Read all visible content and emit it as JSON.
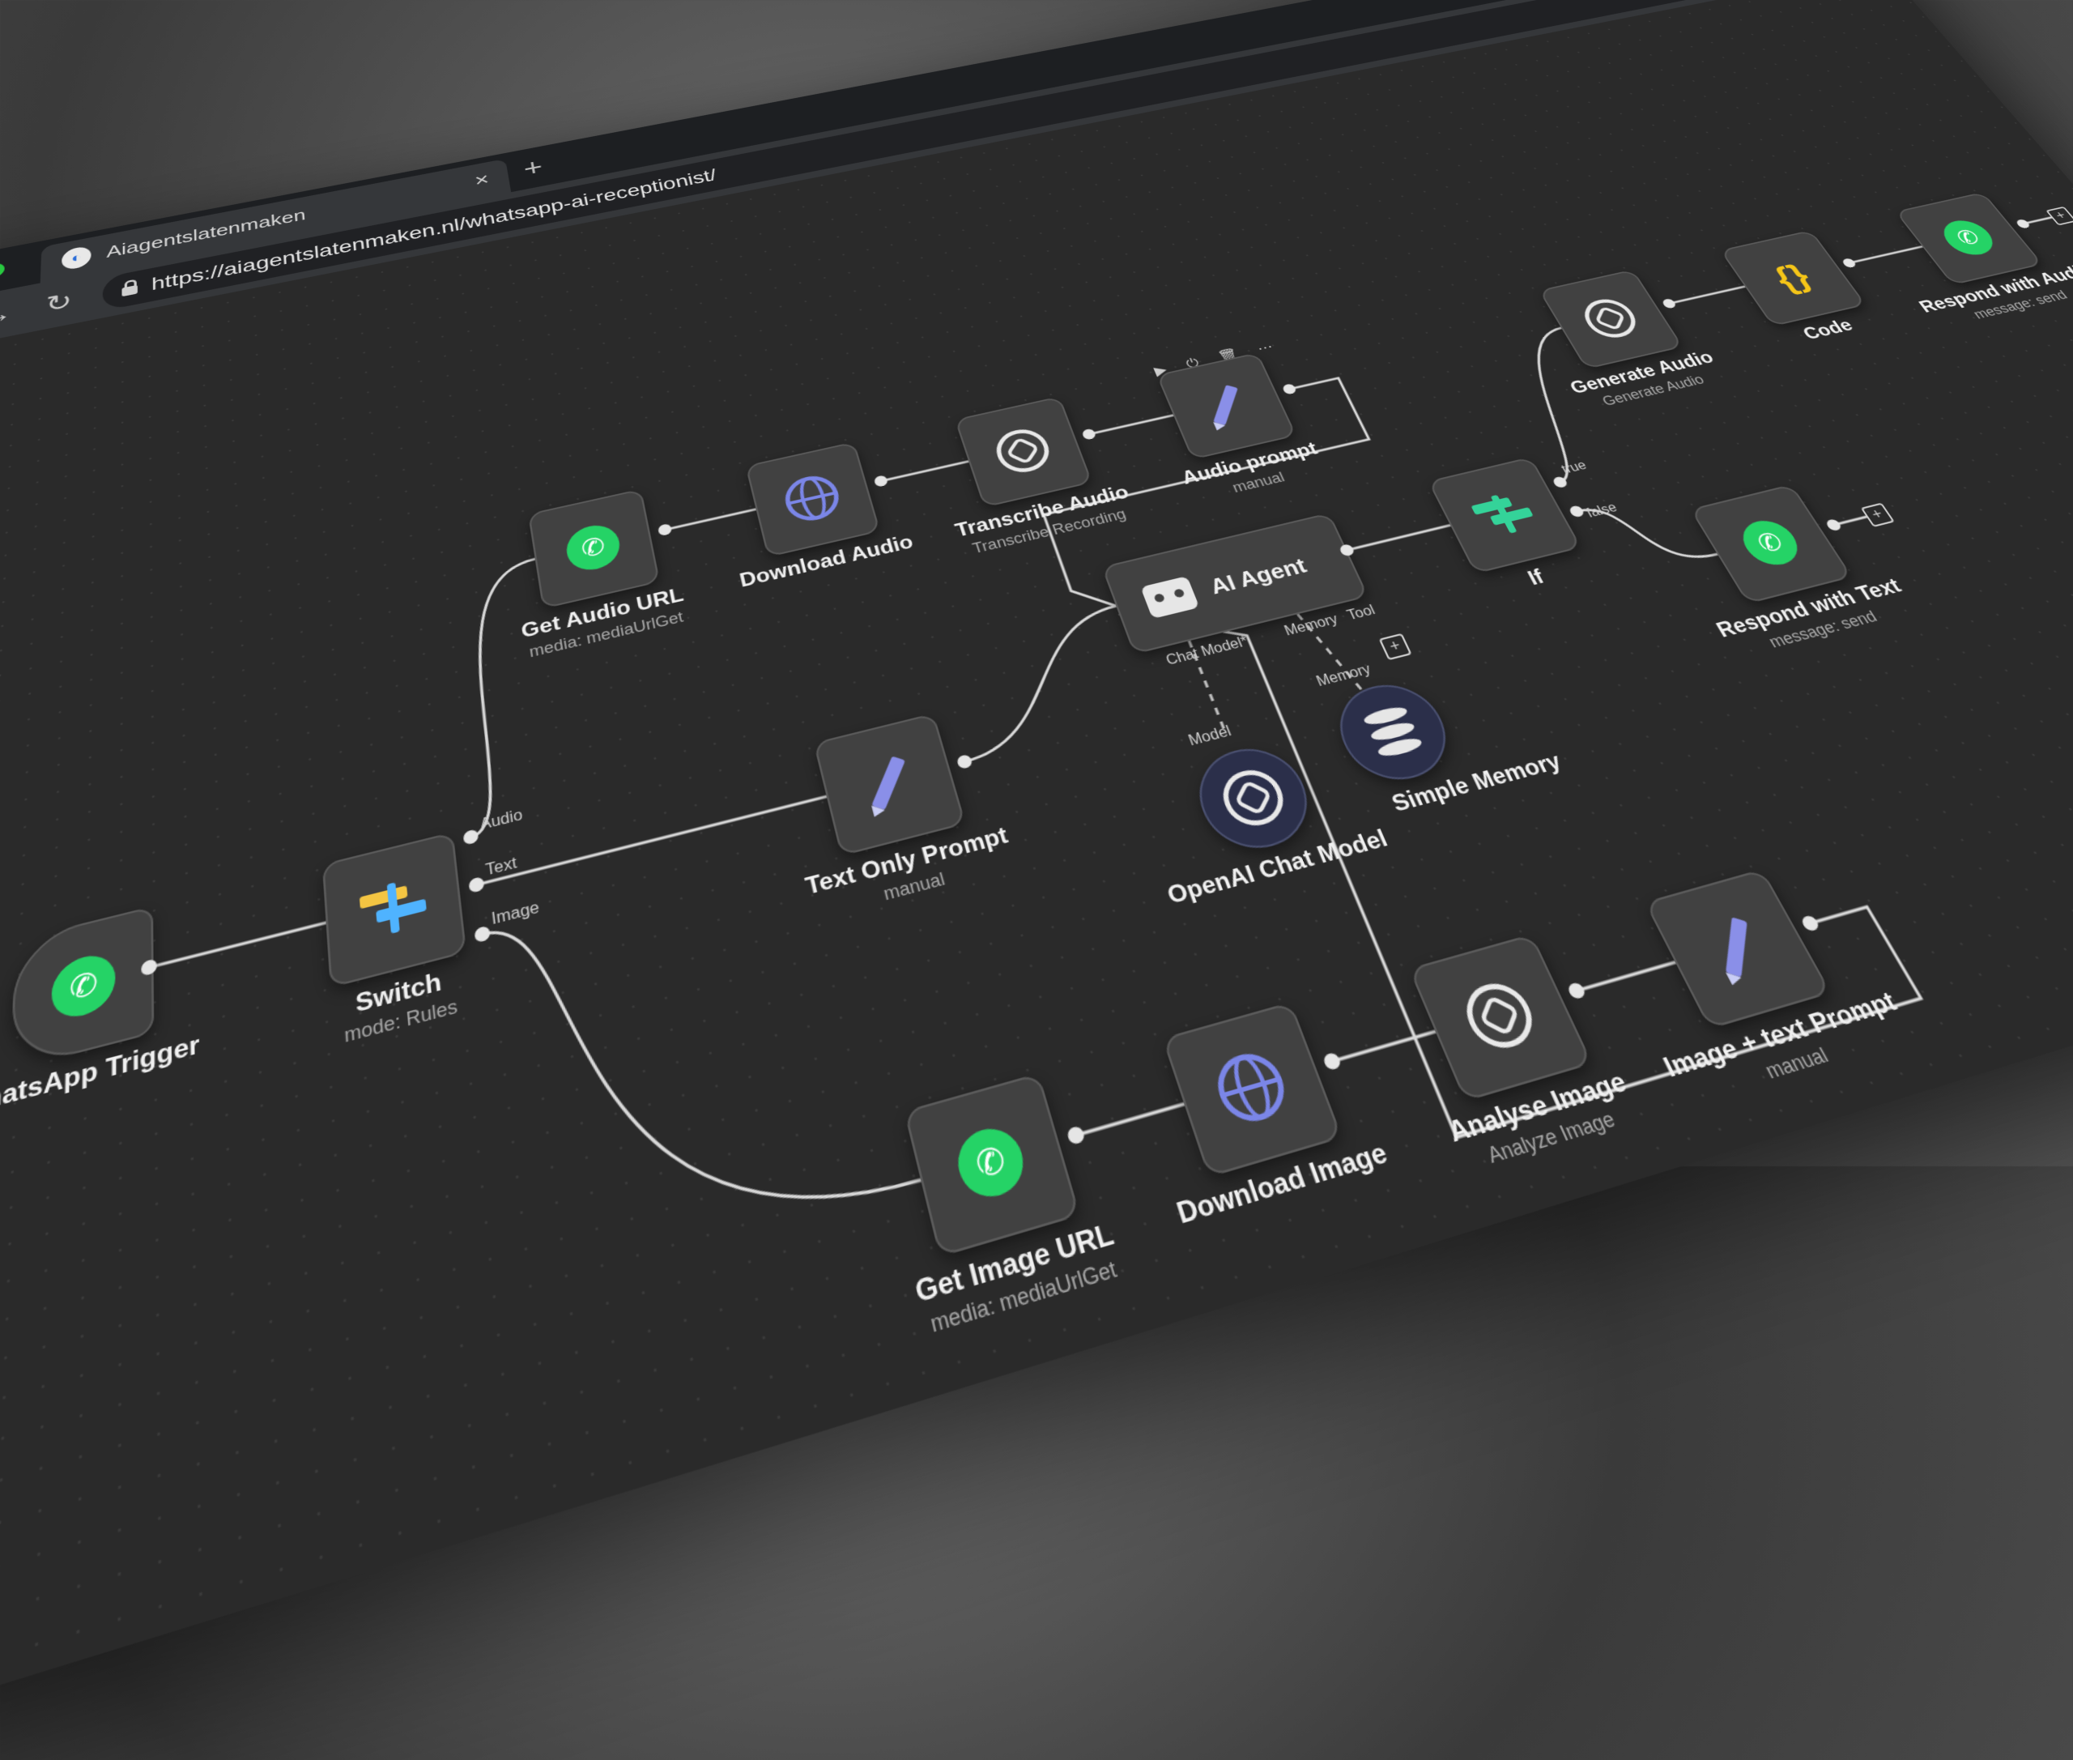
{
  "browser": {
    "tab_title": "Aiagentslatenmaken",
    "tab_close": "×",
    "new_tab": "+",
    "url": "https://aiagentslatenmaken.nl/whatsapp-ai-receptionist/",
    "colors": {
      "red": "#ff5f57",
      "yellow": "#febc2e",
      "green": "#28c840"
    }
  },
  "nav": {
    "back": "←",
    "forward": "→",
    "reload": "↻"
  },
  "node_toolbar": "▶ ⏻ 🗑 ⋯",
  "nodes": {
    "whatsapp_trigger": {
      "label": "WhatsApp Trigger",
      "icon": "whatsapp-icon"
    },
    "switch": {
      "label": "Switch",
      "sub": "mode: Rules",
      "icon": "switch-icon",
      "outputs": [
        "Audio",
        "Text",
        "Image"
      ]
    },
    "get_audio_url": {
      "label": "Get Audio URL",
      "sub": "media: mediaUrlGet",
      "icon": "whatsapp-icon"
    },
    "download_audio": {
      "label": "Download Audio",
      "icon": "globe-icon"
    },
    "transcribe_audio": {
      "label": "Transcribe Audio",
      "sub": "Transcribe Recording",
      "icon": "openai-icon"
    },
    "audio_prompt": {
      "label": "Audio prompt",
      "sub": "manual",
      "icon": "pencil-icon"
    },
    "text_only_prompt": {
      "label": "Text Only Prompt",
      "sub": "manual",
      "icon": "pencil-icon"
    },
    "ai_agent": {
      "label": "AI Agent",
      "icon": "robot-icon",
      "inputs": [
        "Chat Model*",
        "Memory",
        "Tool"
      ]
    },
    "openai_chat_model": {
      "label": "OpenAI Chat Model",
      "icon": "openai-icon",
      "port_label": "Model"
    },
    "simple_memory": {
      "label": "Simple Memory",
      "icon": "database-icon",
      "port_label": "Memory"
    },
    "if": {
      "label": "If",
      "icon": "switch-icon",
      "outputs": [
        "true",
        "false"
      ]
    },
    "generate_audio": {
      "label": "Generate Audio",
      "sub": "Generate Audio",
      "icon": "openai-icon"
    },
    "code": {
      "label": "Code",
      "icon": "code-braces-icon"
    },
    "respond_with_audio": {
      "label": "Respond with Audio",
      "sub": "message: send",
      "icon": "whatsapp-icon"
    },
    "respond_with_text": {
      "label": "Respond with Text",
      "sub": "message: send",
      "icon": "whatsapp-icon"
    },
    "get_image_url": {
      "label": "Get Image URL",
      "sub": "media: mediaUrlGet",
      "icon": "whatsapp-icon"
    },
    "download_image": {
      "label": "Download Image",
      "icon": "globe-icon"
    },
    "analyse_image": {
      "label": "Analyse Image",
      "sub": "Analyze Image",
      "icon": "openai-icon"
    },
    "image_text_prompt": {
      "label": "Image + text Prompt",
      "sub": "manual",
      "icon": "pencil-icon"
    }
  },
  "glyphs": {
    "whatsapp": "✆",
    "braces": "{}",
    "plus": "+",
    "bolt": "ϟ"
  }
}
